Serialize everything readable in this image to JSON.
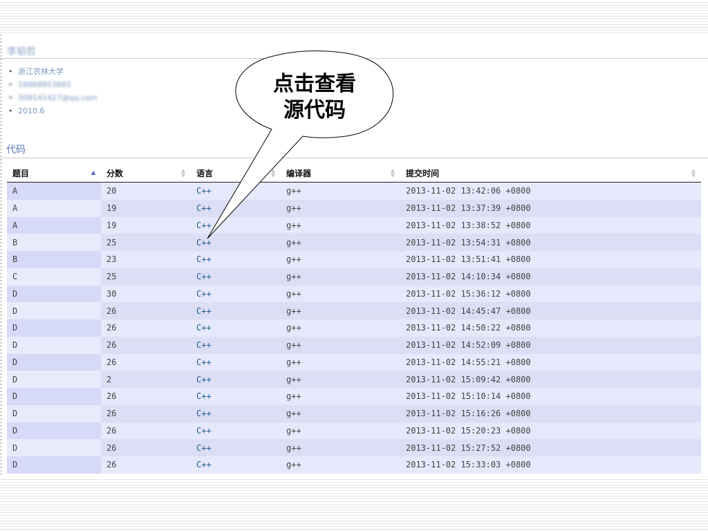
{
  "profile": {
    "name": "李韬哲",
    "info": [
      "浙江农林大学",
      "18868853685",
      "308141427@qq.com",
      "2010.6"
    ]
  },
  "section_title": "代码",
  "table": {
    "headers": [
      "题目",
      "分数",
      "语言",
      "编译器",
      "提交时间"
    ],
    "rows": [
      [
        "A",
        "20",
        "C++",
        "g++",
        "2013-11-02 13:42:06 +0800"
      ],
      [
        "A",
        "19",
        "C++",
        "g++",
        "2013-11-02 13:37:39 +0800"
      ],
      [
        "A",
        "19",
        "C++",
        "g++",
        "2013-11-02 13:38:52 +0800"
      ],
      [
        "B",
        "25",
        "C++",
        "g++",
        "2013-11-02 13:54:31 +0800"
      ],
      [
        "B",
        "23",
        "C++",
        "g++",
        "2013-11-02 13:51:41 +0800"
      ],
      [
        "C",
        "25",
        "C++",
        "g++",
        "2013-11-02 14:10:34 +0800"
      ],
      [
        "D",
        "30",
        "C++",
        "g++",
        "2013-11-02 15:36:12 +0800"
      ],
      [
        "D",
        "26",
        "C++",
        "g++",
        "2013-11-02 14:45:47 +0800"
      ],
      [
        "D",
        "26",
        "C++",
        "g++",
        "2013-11-02 14:50:22 +0800"
      ],
      [
        "D",
        "26",
        "C++",
        "g++",
        "2013-11-02 14:52:09 +0800"
      ],
      [
        "D",
        "26",
        "C++",
        "g++",
        "2013-11-02 14:55:21 +0800"
      ],
      [
        "D",
        "2",
        "C++",
        "g++",
        "2013-11-02 15:09:42 +0800"
      ],
      [
        "D",
        "26",
        "C++",
        "g++",
        "2013-11-02 15:10:14 +0800"
      ],
      [
        "D",
        "26",
        "C++",
        "g++",
        "2013-11-02 15:16:26 +0800"
      ],
      [
        "D",
        "26",
        "C++",
        "g++",
        "2013-11-02 15:20:23 +0800"
      ],
      [
        "D",
        "26",
        "C++",
        "g++",
        "2013-11-02 15:27:52 +0800"
      ],
      [
        "D",
        "26",
        "C++",
        "g++",
        "2013-11-02 15:33:03 +0800"
      ]
    ]
  },
  "callout": {
    "line1": "点击查看",
    "line2": "源代码"
  },
  "colors": {
    "link": "#1c5a8e",
    "heading": "#5d7ab5",
    "sort_active": "#4a63b7"
  },
  "icons": {
    "sort_active": "sort-ascending-icon",
    "sort_idle": "sort-both-icon"
  }
}
